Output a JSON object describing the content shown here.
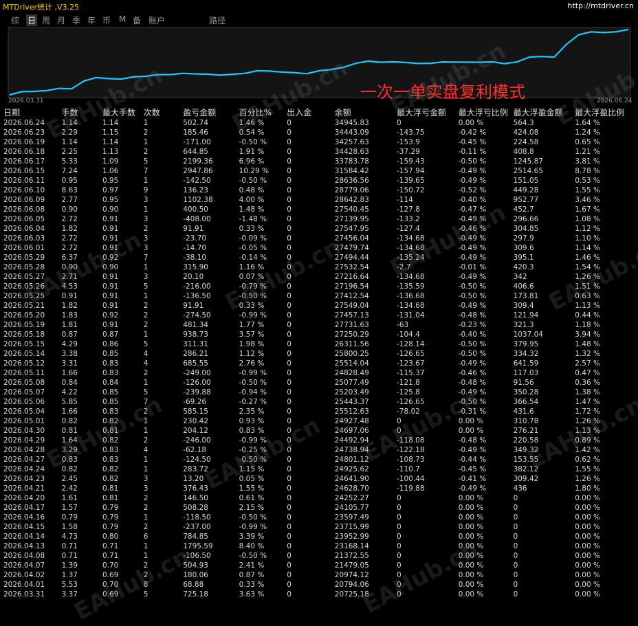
{
  "app": {
    "title": "MTDriver统计 ,V3.25",
    "url": "http://mtdriver.cn"
  },
  "tabs": [
    "综",
    "日",
    "周",
    "月",
    "季",
    "年",
    "币",
    "M",
    "备",
    "账户",
    "路径"
  ],
  "active_tab": 1,
  "chart": {
    "title": "一次一单实盘复利模式",
    "start_label": "2026.03.31",
    "end_label": "2026.06.24",
    "line_color": "#1ec8ff",
    "watermark": "EAHub.cn"
  },
  "columns": [
    "日期",
    "手数",
    "最大手数",
    "次数",
    "盈亏金额",
    "百分比%",
    "出入金",
    "余额",
    "最大浮亏金额",
    "最大浮亏比例",
    "最大浮盈金额",
    "最大浮盈比例"
  ],
  "rows": [
    [
      "2026.06.24",
      "1.14",
      "1.14",
      "1",
      "502.74",
      "1.46 %",
      "0",
      "34945.83",
      "0",
      "0.00 %",
      "564.3",
      "1.64 %"
    ],
    [
      "2026.06.23",
      "2.29",
      "1.15",
      "2",
      "185.46",
      "0.54 %",
      "0",
      "34443.09",
      "-143.75",
      "-0.42 %",
      "424.08",
      "1.24 %"
    ],
    [
      "2026.06.19",
      "1.14",
      "1.14",
      "1",
      "-171.00",
      "-0.50 %",
      "0",
      "34257.63",
      "-153.9",
      "-0.45 %",
      "224.58",
      "0.65 %"
    ],
    [
      "2026.06.18",
      "2.25",
      "1.13",
      "2",
      "644.85",
      "1.91 %",
      "0",
      "34428.63",
      "-37.29",
      "-0.11 %",
      "408.8",
      "1.21 %"
    ],
    [
      "2026.06.17",
      "5.33",
      "1.09",
      "5",
      "2199.36",
      "6.96 %",
      "0",
      "33783.78",
      "-159.43",
      "-0.50 %",
      "1245.87",
      "3.81 %"
    ],
    [
      "2026.06.15",
      "7.24",
      "1.06",
      "7",
      "2947.86",
      "10.29 %",
      "0",
      "31584.42",
      "-157.94",
      "-0.49 %",
      "2514.65",
      "8.78 %"
    ],
    [
      "2026.06.11",
      "0.95",
      "0.95",
      "1",
      "-142.50",
      "-0.50 %",
      "0",
      "28636.56",
      "-139.65",
      "-0.49 %",
      "151.05",
      "0.53 %"
    ],
    [
      "2026.06.10",
      "8.63",
      "0.97",
      "9",
      "136.23",
      "0.48 %",
      "0",
      "28779.06",
      "-150.72",
      "-0.52 %",
      "449.28",
      "1.55 %"
    ],
    [
      "2026.06.09",
      "2.77",
      "0.95",
      "3",
      "1102.38",
      "4.00 %",
      "0",
      "28642.83",
      "-114",
      "-0.40 %",
      "952.77",
      "3.46 %"
    ],
    [
      "2026.06.08",
      "0.90",
      "0.90",
      "1",
      "400.50",
      "1.48 %",
      "0",
      "27540.45",
      "-127.8",
      "-0.47 %",
      "452.7",
      "1.67 %"
    ],
    [
      "2026.06.05",
      "2.72",
      "0.91",
      "3",
      "-408.00",
      "-1.48 %",
      "0",
      "27139.95",
      "-133.2",
      "-0.49 %",
      "296.66",
      "1.08 %"
    ],
    [
      "2026.06.04",
      "1.82",
      "0.91",
      "2",
      "91.91",
      "0.33 %",
      "0",
      "27547.95",
      "-127.4",
      "-0.46 %",
      "304.85",
      "1.12 %"
    ],
    [
      "2026.06.03",
      "2.72",
      "0.91",
      "3",
      "-23.70",
      "-0.09 %",
      "0",
      "27456.04",
      "-134.68",
      "-0.49 %",
      "297.9",
      "1.10 %"
    ],
    [
      "2026.06.01",
      "2.72",
      "0.91",
      "3",
      "-14.70",
      "-0.05 %",
      "0",
      "27479.74",
      "-134.68",
      "-0.49 %",
      "309.6",
      "1.14 %"
    ],
    [
      "2026.05.29",
      "6.37",
      "0.92",
      "7",
      "-38.10",
      "-0.14 %",
      "0",
      "27494.44",
      "-135.24",
      "-0.49 %",
      "395.1",
      "1.46 %"
    ],
    [
      "2026.05.28",
      "0.90",
      "0.90",
      "1",
      "315.90",
      "1.16 %",
      "0",
      "27532.54",
      "-2.7",
      "-0.01 %",
      "420.3",
      "1.54 %"
    ],
    [
      "2026.05.27",
      "2.71",
      "0.91",
      "3",
      "20.10",
      "0.07 %",
      "0",
      "27216.64",
      "-134.68",
      "-0.49 %",
      "342",
      "1.26 %"
    ],
    [
      "2026.05.26",
      "4.53",
      "0.91",
      "5",
      "-216.00",
      "-0.79 %",
      "0",
      "27196.54",
      "-135.59",
      "-0.50 %",
      "406.6",
      "1.51 %"
    ],
    [
      "2026.05.25",
      "0.91",
      "0.91",
      "1",
      "-136.50",
      "-0.50 %",
      "0",
      "27412.54",
      "-136.68",
      "-0.50 %",
      "173.81",
      "0.63 %"
    ],
    [
      "2026.05.21",
      "1.82",
      "0.91",
      "2",
      "91.91",
      "0.33 %",
      "0",
      "27549.04",
      "-134.68",
      "-0.49 %",
      "309.4",
      "1.13 %"
    ],
    [
      "2026.05.20",
      "1.83",
      "0.92",
      "2",
      "-274.50",
      "-0.99 %",
      "0",
      "27457.13",
      "-131.04",
      "-0.48 %",
      "121.94",
      "0.44 %"
    ],
    [
      "2026.05.19",
      "1.81",
      "0.91",
      "2",
      "481.34",
      "1.77 %",
      "0",
      "27731.63",
      "-63",
      "-0.23 %",
      "321.3",
      "1.18 %"
    ],
    [
      "2026.05.18",
      "0.87",
      "0.87",
      "1",
      "938.73",
      "3.57 %",
      "0",
      "27250.29",
      "-104.4",
      "-0.40 %",
      "1037.04",
      "3.94 %"
    ],
    [
      "2026.05.15",
      "4.29",
      "0.86",
      "5",
      "311.31",
      "1.98 %",
      "0",
      "26311.56",
      "-128.14",
      "-0.50 %",
      "379.95",
      "1.48 %"
    ],
    [
      "2026.05.14",
      "3.38",
      "0.85",
      "4",
      "286.21",
      "1.12 %",
      "0",
      "25800.25",
      "-126.65",
      "-0.50 %",
      "334.32",
      "1.32 %"
    ],
    [
      "2026.05.12",
      "3.31",
      "0.83",
      "4",
      "685.55",
      "2.76 %",
      "0",
      "25514.04",
      "-123.67",
      "-0.49 %",
      "641.59",
      "2.57 %"
    ],
    [
      "2026.05.11",
      "1.66",
      "0.83",
      "2",
      "-249.00",
      "-0.99 %",
      "0",
      "24828.49",
      "-115.37",
      "-0.46 %",
      "117.03",
      "0.47 %"
    ],
    [
      "2026.05.08",
      "0.84",
      "0.84",
      "1",
      "-126.00",
      "-0.50 %",
      "0",
      "25077.49",
      "-121.8",
      "-0.48 %",
      "91.56",
      "0.36 %"
    ],
    [
      "2026.05.07",
      "4.22",
      "0.85",
      "5",
      "-239.88",
      "-0.94 %",
      "0",
      "25203.49",
      "-125.8",
      "-0.49 %",
      "350.28",
      "1.38 %"
    ],
    [
      "2026.05.06",
      "5.85",
      "0.85",
      "7",
      "-69.26",
      "-0.27 %",
      "0",
      "25443.37",
      "-126.65",
      "-0.50 %",
      "366.54",
      "1.47 %"
    ],
    [
      "2026.05.04",
      "1.66",
      "0.83",
      "2",
      "585.15",
      "2.35 %",
      "0",
      "25512.63",
      "-78.02",
      "-0.31 %",
      "431.6",
      "1.72 %"
    ],
    [
      "2026.05.01",
      "0.82",
      "0.82",
      "1",
      "230.42",
      "0.93 %",
      "0",
      "24927.48",
      "0",
      "0.00 %",
      "310.78",
      "1.26 %"
    ],
    [
      "2026.04.30",
      "0.81",
      "0.81",
      "1",
      "204.12",
      "0.83 %",
      "0",
      "24697.06",
      "0",
      "0.00 %",
      "276.21",
      "1.13 %"
    ],
    [
      "2026.04.29",
      "1.64",
      "0.82",
      "2",
      "-246.00",
      "-0.99 %",
      "0",
      "24492.94",
      "-118.08",
      "-0.48 %",
      "220.58",
      "0.89 %"
    ],
    [
      "2026.04.28",
      "3.29",
      "0.83",
      "4",
      "-62.18",
      "-0.25 %",
      "0",
      "24738.94",
      "-122.18",
      "-0.49 %",
      "349.32",
      "1.42 %"
    ],
    [
      "2026.04.27",
      "0.83",
      "0.83",
      "1",
      "-124.50",
      "-0.50 %",
      "0",
      "24801.12",
      "-108.73",
      "-0.44 %",
      "153.55",
      "0.62 %"
    ],
    [
      "2026.04.24",
      "0.82",
      "0.82",
      "1",
      "283.72",
      "1.15 %",
      "0",
      "24925.62",
      "-110.7",
      "-0.45 %",
      "382.12",
      "1.55 %"
    ],
    [
      "2026.04.23",
      "2.45",
      "0.82",
      "3",
      "13.20",
      "0.05 %",
      "0",
      "24641.90",
      "-100.44",
      "-0.41 %",
      "309.42",
      "1.26 %"
    ],
    [
      "2026.04.21",
      "2.42",
      "0.81",
      "3",
      "376.43",
      "1.55 %",
      "0",
      "24628.70",
      "-119.88",
      "-0.49 %",
      "436",
      "1.80 %"
    ],
    [
      "2026.04.20",
      "1.61",
      "0.81",
      "2",
      "146.50",
      "0.61 %",
      "0",
      "24252.27",
      "0",
      "0.00 %",
      "0",
      "0.00 %"
    ],
    [
      "2026.04.17",
      "1.57",
      "0.79",
      "2",
      "508.28",
      "2.15 %",
      "0",
      "24105.77",
      "0",
      "0.00 %",
      "0",
      "0.00 %"
    ],
    [
      "2026.04.16",
      "0.79",
      "0.79",
      "1",
      "-118.50",
      "-0.50 %",
      "0",
      "23597.49",
      "0",
      "0.00 %",
      "0",
      "0.00 %"
    ],
    [
      "2026.04.15",
      "1.58",
      "0.79",
      "2",
      "-237.00",
      "-0.99 %",
      "0",
      "23715.99",
      "0",
      "0.00 %",
      "0",
      "0.00 %"
    ],
    [
      "2026.04.14",
      "4.73",
      "0.80",
      "6",
      "784.85",
      "3.39 %",
      "0",
      "23952.99",
      "0",
      "0.00 %",
      "0",
      "0.00 %"
    ],
    [
      "2026.04.13",
      "0.71",
      "0.71",
      "1",
      "1795.59",
      "8.40 %",
      "0",
      "23168.14",
      "0",
      "0.00 %",
      "0",
      "0.00 %"
    ],
    [
      "2026.04.08",
      "0.71",
      "0.71",
      "1",
      "-106.50",
      "-0.50 %",
      "0",
      "21372.55",
      "0",
      "0.00 %",
      "0",
      "0.00 %"
    ],
    [
      "2026.04.07",
      "1.39",
      "0.70",
      "2",
      "504.93",
      "2.41 %",
      "0",
      "21479.05",
      "0",
      "0.00 %",
      "0",
      "0.00 %"
    ],
    [
      "2026.04.02",
      "1.37",
      "0.69",
      "2",
      "180.06",
      "0.87 %",
      "0",
      "20974.12",
      "0",
      "0.00 %",
      "0",
      "0.00 %"
    ],
    [
      "2026.04.01",
      "5.53",
      "0.70",
      "8",
      "68.88",
      "0.33 %",
      "0",
      "20794.06",
      "0",
      "0.00 %",
      "0",
      "0.00 %"
    ],
    [
      "2026.03.31",
      "3.37",
      "0.69",
      "5",
      "725.18",
      "3.63 %",
      "0",
      "20725.18",
      "0",
      "0.00 %",
      "0",
      "0.00 %"
    ]
  ]
}
